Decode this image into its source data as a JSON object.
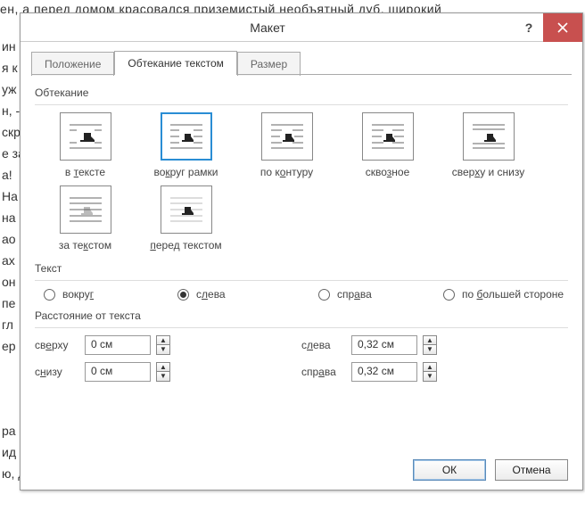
{
  "dialog": {
    "title": "Макет"
  },
  "tabs": {
    "position": "Положение",
    "wrap": "Обтекание текстом",
    "size": "Размер"
  },
  "sections": {
    "wrapping": "Обтекание",
    "text": "Текст",
    "distance": "Расстояние от текста"
  },
  "wrap_items": {
    "inline": {
      "pre": "в ",
      "u": "т",
      "post": "ексте"
    },
    "square": {
      "pre": "во",
      "u": "к",
      "post": "руг рамки"
    },
    "tight": {
      "pre": "по к",
      "u": "о",
      "post": "нтуру"
    },
    "through": {
      "pre": "скво",
      "u": "з",
      "post": "ное"
    },
    "topbot": {
      "pre": "свер",
      "u": "х",
      "post": "у и снизу"
    },
    "behind": {
      "pre": "за те",
      "u": "к",
      "post": "стом"
    },
    "front": {
      "pre": "",
      "u": "п",
      "post": "еред текстом"
    }
  },
  "text_opts": {
    "both": {
      "pre": "вокру",
      "u": "г",
      "post": ""
    },
    "left": {
      "pre": "с",
      "u": "л",
      "post": "ева"
    },
    "right": {
      "pre": "спр",
      "u": "а",
      "post": "ва"
    },
    "largest": {
      "pre": "по ",
      "u": "б",
      "post": "ольшей стороне"
    }
  },
  "distance": {
    "top": {
      "pre": "св",
      "u": "е",
      "post": "рху",
      "value": "0 см"
    },
    "bottom": {
      "pre": "с",
      "u": "н",
      "post": "изу",
      "value": "0 см"
    },
    "left": {
      "pre": "с",
      "u": "л",
      "post": "ева",
      "value": "0,32 см"
    },
    "right": {
      "pre": "спр",
      "u": "а",
      "post": "ва",
      "value": "0,32 см"
    }
  },
  "buttons": {
    "ok": "ОК",
    "cancel": "Отмена"
  }
}
